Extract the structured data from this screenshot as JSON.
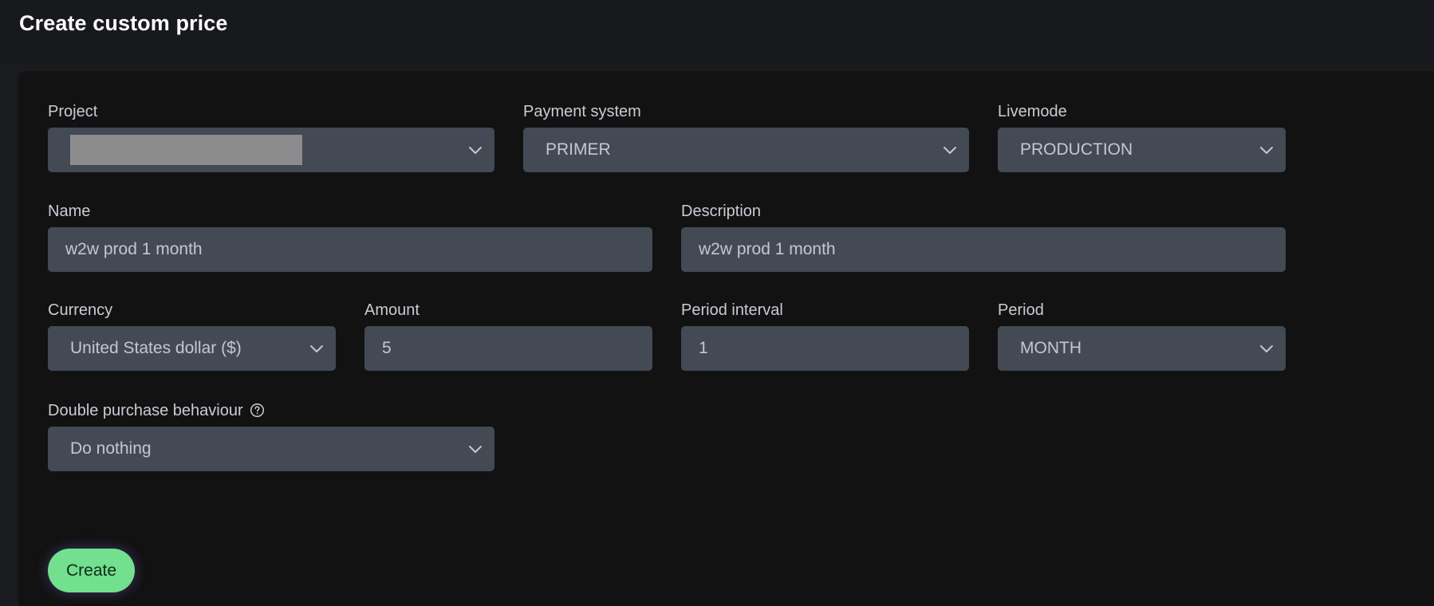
{
  "page": {
    "title": "Create custom price"
  },
  "form": {
    "project": {
      "label": "Project",
      "value": ""
    },
    "payment_system": {
      "label": "Payment system",
      "value": "PRIMER"
    },
    "livemode": {
      "label": "Livemode",
      "value": "PRODUCTION"
    },
    "name": {
      "label": "Name",
      "value": "w2w prod 1 month"
    },
    "description": {
      "label": "Description",
      "value": "w2w prod 1 month"
    },
    "currency": {
      "label": "Currency",
      "value": "United States dollar ($)"
    },
    "amount": {
      "label": "Amount",
      "value": "5"
    },
    "period_interval": {
      "label": "Period interval",
      "value": "1"
    },
    "period": {
      "label": "Period",
      "value": "MONTH"
    },
    "double_purchase": {
      "label": "Double purchase behaviour",
      "value": "Do nothing",
      "help_icon": "question-circle-icon"
    }
  },
  "actions": {
    "create_label": "Create"
  },
  "colors": {
    "background": "#121212",
    "control": "#434a54",
    "accent": "#72e08e",
    "text": "#c3c8cf"
  }
}
